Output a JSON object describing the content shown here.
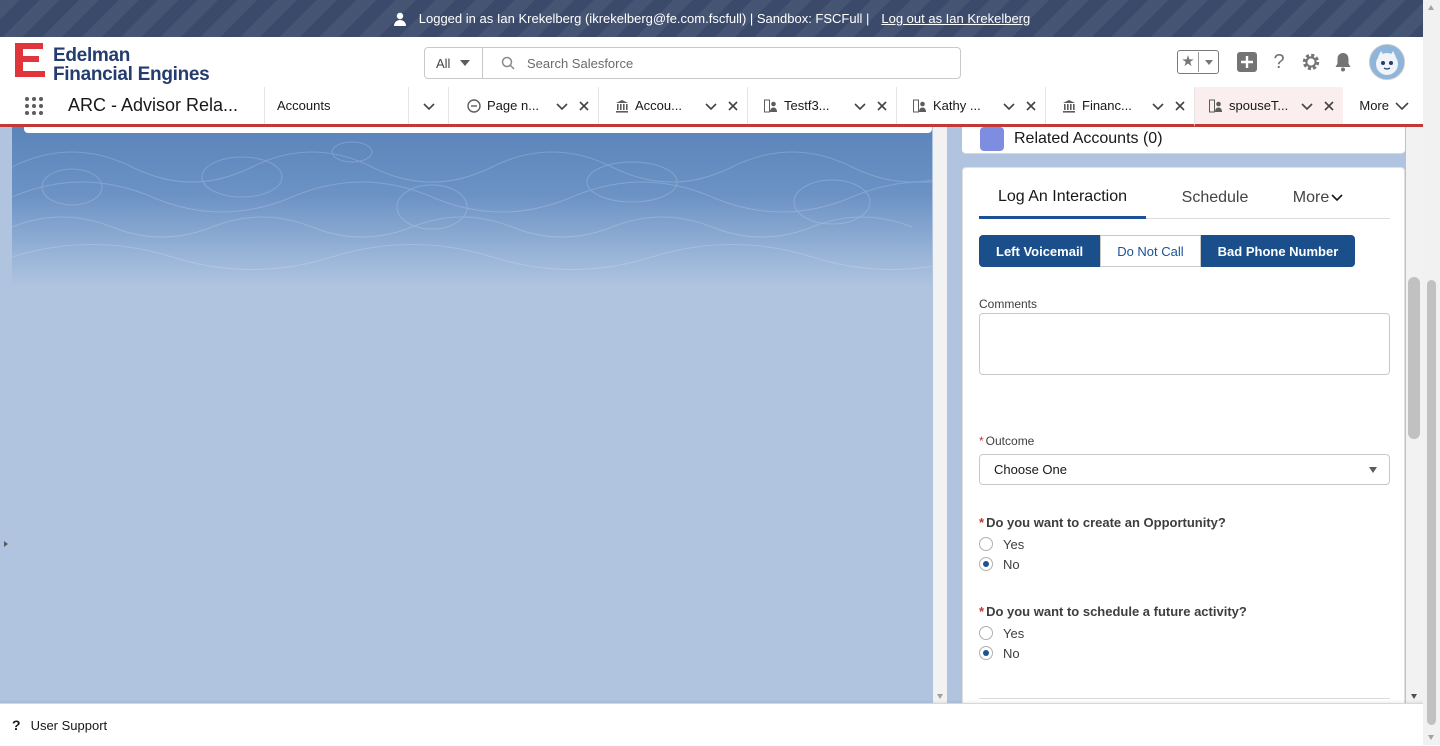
{
  "banner": {
    "logged_in_text": "Logged in as Ian Krekelberg (ikrekelberg@fe.com.fscfull) | Sandbox: FSCFull |",
    "logout_link": "Log out as Ian Krekelberg"
  },
  "header": {
    "logo_line1": "Edelman",
    "logo_line2": "Financial Engines",
    "search_scope": "All",
    "search_placeholder": "Search Salesforce"
  },
  "nav": {
    "app_name": "ARC - Advisor Rela...",
    "accounts_tab": "Accounts",
    "tabs": [
      {
        "label": "Page n...",
        "icon": "minus-circle-icon"
      },
      {
        "label": "Accou...",
        "icon": "bank-icon"
      },
      {
        "label": "Testf3...",
        "icon": "person-account-icon"
      },
      {
        "label": "Kathy ...",
        "icon": "person-account-icon"
      },
      {
        "label": "Financ...",
        "icon": "bank-icon"
      },
      {
        "label": "spouseT...",
        "icon": "person-account-icon",
        "active": true
      }
    ],
    "more_label": "More"
  },
  "related": {
    "title": "Related Accounts (0)"
  },
  "interaction_panel": {
    "tabs": [
      "Log An Interaction",
      "Schedule",
      "More"
    ],
    "quick_buttons": [
      "Left Voicemail",
      "Do Not Call",
      "Bad Phone Number"
    ],
    "comments_label": "Comments",
    "comments_value": "",
    "outcome_label": "Outcome",
    "outcome_value": "Choose One",
    "q1": "Do you want to create an Opportunity?",
    "q1_options": [
      "Yes",
      "No"
    ],
    "q1_selected": "No",
    "q2": "Do you want to schedule a future activity?",
    "q2_options": [
      "Yes",
      "No"
    ],
    "q2_selected": "No",
    "required_marker": "*"
  },
  "footer": {
    "user_support": "User Support",
    "help_glyph": "?"
  },
  "colors": {
    "banner_bg": "#3b4a6b",
    "brand_button": "#1b4f8c",
    "tab_accent": "#c23934",
    "logo_red": "#e0353b",
    "logo_navy": "#243c6e"
  }
}
